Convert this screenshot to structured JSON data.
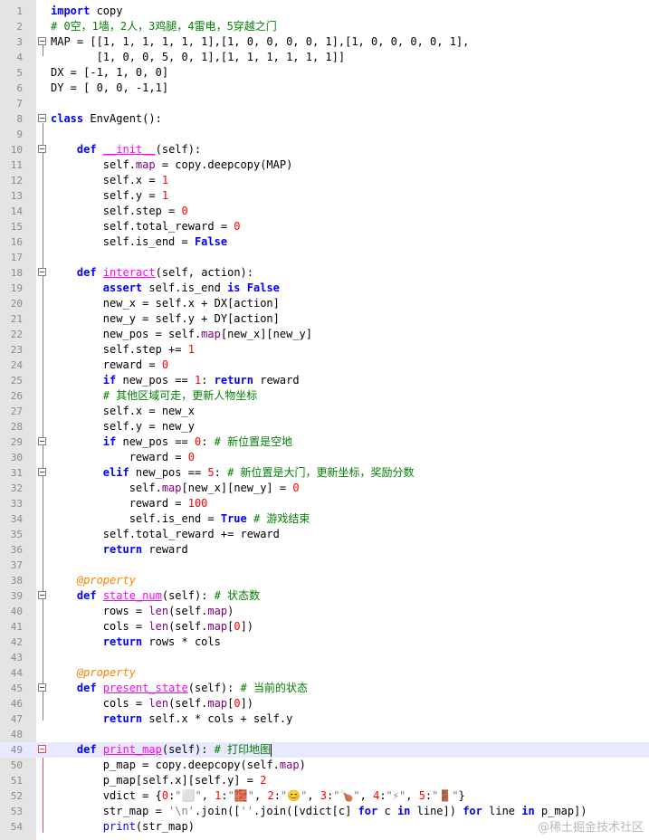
{
  "watermark": "@稀土掘金技术社区",
  "lines": [
    {
      "n": "1",
      "fold": "",
      "current": false,
      "tokens": [
        [
          "kw",
          "import"
        ],
        [
          "t",
          " copy"
        ]
      ]
    },
    {
      "n": "2",
      "fold": "",
      "current": false,
      "tokens": [
        [
          "cm",
          "# 0空，1墙，2人，3鸡腿，4雷电，5穿越之门"
        ]
      ]
    },
    {
      "n": "3",
      "fold": "box",
      "current": false,
      "tokens": [
        [
          "t",
          "MAP = [[1, 1, 1, 1, 1, 1],[1, 0, 0, 0, 0, 1],[1, 0, 0, 0, 0, 1],"
        ]
      ]
    },
    {
      "n": "4",
      "fold": "",
      "current": false,
      "tokens": [
        [
          "t",
          "       [1, 0, 0, 5, 0, 1],[1, 1, 1, 1, 1, 1]]"
        ]
      ]
    },
    {
      "n": "5",
      "fold": "",
      "current": false,
      "tokens": [
        [
          "t",
          "DX = [-1, 1, 0, 0]"
        ]
      ]
    },
    {
      "n": "6",
      "fold": "",
      "current": false,
      "tokens": [
        [
          "t",
          "DY = [ 0, 0, -1,1]"
        ]
      ]
    },
    {
      "n": "7",
      "fold": "",
      "current": false,
      "tokens": []
    },
    {
      "n": "8",
      "fold": "box",
      "current": false,
      "tokens": [
        [
          "kw",
          "class"
        ],
        [
          "t",
          " EnvAgent():"
        ]
      ]
    },
    {
      "n": "9",
      "fold": "",
      "current": false,
      "tokens": []
    },
    {
      "n": "10",
      "fold": "box",
      "current": false,
      "tokens": [
        [
          "t",
          "    "
        ],
        [
          "kw",
          "def"
        ],
        [
          "t",
          " "
        ],
        [
          "fn",
          "__init__"
        ],
        [
          "t",
          "(self):"
        ]
      ]
    },
    {
      "n": "11",
      "fold": "",
      "current": false,
      "tokens": [
        [
          "t",
          "        self."
        ],
        [
          "bi",
          "map"
        ],
        [
          "t",
          " = copy.deepcopy(MAP)"
        ]
      ]
    },
    {
      "n": "12",
      "fold": "",
      "current": false,
      "tokens": [
        [
          "t",
          "        self.x = "
        ],
        [
          "num",
          "1"
        ]
      ]
    },
    {
      "n": "13",
      "fold": "",
      "current": false,
      "tokens": [
        [
          "t",
          "        self.y = "
        ],
        [
          "num",
          "1"
        ]
      ]
    },
    {
      "n": "14",
      "fold": "",
      "current": false,
      "tokens": [
        [
          "t",
          "        self.step = "
        ],
        [
          "num",
          "0"
        ]
      ]
    },
    {
      "n": "15",
      "fold": "",
      "current": false,
      "tokens": [
        [
          "t",
          "        self.total_reward = "
        ],
        [
          "num",
          "0"
        ]
      ]
    },
    {
      "n": "16",
      "fold": "",
      "current": false,
      "tokens": [
        [
          "t",
          "        self.is_end = "
        ],
        [
          "kw",
          "False"
        ]
      ]
    },
    {
      "n": "17",
      "fold": "",
      "current": false,
      "tokens": []
    },
    {
      "n": "18",
      "fold": "box",
      "current": false,
      "tokens": [
        [
          "t",
          "    "
        ],
        [
          "kw",
          "def"
        ],
        [
          "t",
          " "
        ],
        [
          "fn",
          "interact"
        ],
        [
          "t",
          "(self, action):"
        ]
      ]
    },
    {
      "n": "19",
      "fold": "",
      "current": false,
      "tokens": [
        [
          "t",
          "        "
        ],
        [
          "kw",
          "assert"
        ],
        [
          "t",
          " self.is_end "
        ],
        [
          "kw",
          "is"
        ],
        [
          "t",
          " "
        ],
        [
          "kw",
          "False"
        ]
      ]
    },
    {
      "n": "20",
      "fold": "",
      "current": false,
      "tokens": [
        [
          "t",
          "        new_x = self.x + DX[action]"
        ]
      ]
    },
    {
      "n": "21",
      "fold": "",
      "current": false,
      "tokens": [
        [
          "t",
          "        new_y = self.y + DY[action]"
        ]
      ]
    },
    {
      "n": "22",
      "fold": "",
      "current": false,
      "tokens": [
        [
          "t",
          "        new_pos = self."
        ],
        [
          "bi",
          "map"
        ],
        [
          "t",
          "[new_x][new_y]"
        ]
      ]
    },
    {
      "n": "23",
      "fold": "",
      "current": false,
      "tokens": [
        [
          "t",
          "        self.step += "
        ],
        [
          "num",
          "1"
        ]
      ]
    },
    {
      "n": "24",
      "fold": "",
      "current": false,
      "tokens": [
        [
          "t",
          "        reward = "
        ],
        [
          "num",
          "0"
        ]
      ]
    },
    {
      "n": "25",
      "fold": "",
      "current": false,
      "tokens": [
        [
          "t",
          "        "
        ],
        [
          "kw",
          "if"
        ],
        [
          "t",
          " new_pos == "
        ],
        [
          "num",
          "1"
        ],
        [
          "t",
          ": "
        ],
        [
          "kw",
          "return"
        ],
        [
          "t",
          " reward"
        ]
      ]
    },
    {
      "n": "26",
      "fold": "",
      "current": false,
      "tokens": [
        [
          "t",
          "        "
        ],
        [
          "cm",
          "# 其他区域可走，更新人物坐标"
        ]
      ]
    },
    {
      "n": "27",
      "fold": "",
      "current": false,
      "tokens": [
        [
          "t",
          "        self.x = new_x"
        ]
      ]
    },
    {
      "n": "28",
      "fold": "",
      "current": false,
      "tokens": [
        [
          "t",
          "        self.y = new_y"
        ]
      ]
    },
    {
      "n": "29",
      "fold": "box",
      "current": false,
      "tokens": [
        [
          "t",
          "        "
        ],
        [
          "kw",
          "if"
        ],
        [
          "t",
          " new_pos == "
        ],
        [
          "num",
          "0"
        ],
        [
          "t",
          ": "
        ],
        [
          "cm",
          "# 新位置是空地"
        ]
      ]
    },
    {
      "n": "30",
      "fold": "",
      "current": false,
      "tokens": [
        [
          "t",
          "            reward = "
        ],
        [
          "num",
          "0"
        ]
      ]
    },
    {
      "n": "31",
      "fold": "box",
      "current": false,
      "tokens": [
        [
          "t",
          "        "
        ],
        [
          "kw",
          "elif"
        ],
        [
          "t",
          " new_pos == "
        ],
        [
          "num",
          "5"
        ],
        [
          "t",
          ": "
        ],
        [
          "cm",
          "# 新位置是大门，更新坐标，奖励分数"
        ]
      ]
    },
    {
      "n": "32",
      "fold": "",
      "current": false,
      "tokens": [
        [
          "t",
          "            self."
        ],
        [
          "bi",
          "map"
        ],
        [
          "t",
          "[new_x][new_y] = "
        ],
        [
          "num",
          "0"
        ]
      ]
    },
    {
      "n": "33",
      "fold": "",
      "current": false,
      "tokens": [
        [
          "t",
          "            reward = "
        ],
        [
          "num",
          "100"
        ]
      ]
    },
    {
      "n": "34",
      "fold": "",
      "current": false,
      "tokens": [
        [
          "t",
          "            self.is_end = "
        ],
        [
          "kw",
          "True"
        ],
        [
          "t",
          " "
        ],
        [
          "cm",
          "# 游戏结束"
        ]
      ]
    },
    {
      "n": "35",
      "fold": "",
      "current": false,
      "tokens": [
        [
          "t",
          "        self.total_reward += reward"
        ]
      ]
    },
    {
      "n": "36",
      "fold": "",
      "current": false,
      "tokens": [
        [
          "t",
          "        "
        ],
        [
          "kw",
          "return"
        ],
        [
          "t",
          " reward"
        ]
      ]
    },
    {
      "n": "37",
      "fold": "",
      "current": false,
      "tokens": []
    },
    {
      "n": "38",
      "fold": "",
      "current": false,
      "tokens": [
        [
          "t",
          "    "
        ],
        [
          "dec",
          "@property"
        ]
      ]
    },
    {
      "n": "39",
      "fold": "box",
      "current": false,
      "tokens": [
        [
          "t",
          "    "
        ],
        [
          "kw",
          "def"
        ],
        [
          "t",
          " "
        ],
        [
          "fn",
          "state_num"
        ],
        [
          "t",
          "(self): "
        ],
        [
          "cm",
          "# 状态数"
        ]
      ]
    },
    {
      "n": "40",
      "fold": "",
      "current": false,
      "tokens": [
        [
          "t",
          "        rows = "
        ],
        [
          "bi",
          "len"
        ],
        [
          "t",
          "(self."
        ],
        [
          "bi",
          "map"
        ],
        [
          "t",
          ")"
        ]
      ]
    },
    {
      "n": "41",
      "fold": "",
      "current": false,
      "tokens": [
        [
          "t",
          "        cols = "
        ],
        [
          "bi",
          "len"
        ],
        [
          "t",
          "(self."
        ],
        [
          "bi",
          "map"
        ],
        [
          "t",
          "["
        ],
        [
          "num",
          "0"
        ],
        [
          "t",
          "])"
        ]
      ]
    },
    {
      "n": "42",
      "fold": "",
      "current": false,
      "tokens": [
        [
          "t",
          "        "
        ],
        [
          "kw",
          "return"
        ],
        [
          "t",
          " rows * cols"
        ]
      ]
    },
    {
      "n": "43",
      "fold": "",
      "current": false,
      "tokens": []
    },
    {
      "n": "44",
      "fold": "",
      "current": false,
      "tokens": [
        [
          "t",
          "    "
        ],
        [
          "dec",
          "@property"
        ]
      ]
    },
    {
      "n": "45",
      "fold": "box",
      "current": false,
      "tokens": [
        [
          "t",
          "    "
        ],
        [
          "kw",
          "def"
        ],
        [
          "t",
          " "
        ],
        [
          "fn",
          "present_state"
        ],
        [
          "t",
          "(self): "
        ],
        [
          "cm",
          "# 当前的状态"
        ]
      ]
    },
    {
      "n": "46",
      "fold": "",
      "current": false,
      "tokens": [
        [
          "t",
          "        cols = "
        ],
        [
          "bi",
          "len"
        ],
        [
          "t",
          "(self."
        ],
        [
          "bi",
          "map"
        ],
        [
          "t",
          "["
        ],
        [
          "num",
          "0"
        ],
        [
          "t",
          "])"
        ]
      ]
    },
    {
      "n": "47",
      "fold": "",
      "current": false,
      "tokens": [
        [
          "t",
          "        "
        ],
        [
          "kw",
          "return"
        ],
        [
          "t",
          " self.x * cols + self.y"
        ]
      ]
    },
    {
      "n": "48",
      "fold": "",
      "current": false,
      "tokens": []
    },
    {
      "n": "49",
      "fold": "red",
      "current": true,
      "tokens": [
        [
          "t",
          "    "
        ],
        [
          "kw",
          "def"
        ],
        [
          "t",
          " "
        ],
        [
          "fn",
          "print_map"
        ],
        [
          "t",
          "(self): "
        ],
        [
          "cm",
          "# 打印地图"
        ],
        [
          "cursor",
          ""
        ]
      ]
    },
    {
      "n": "50",
      "fold": "",
      "current": false,
      "tokens": [
        [
          "t",
          "        p_map = copy.deepcopy(self."
        ],
        [
          "bi",
          "map"
        ],
        [
          "t",
          ")"
        ]
      ]
    },
    {
      "n": "51",
      "fold": "",
      "current": false,
      "tokens": [
        [
          "t",
          "        p_map[self.x][self.y] = "
        ],
        [
          "num",
          "2"
        ]
      ]
    },
    {
      "n": "52",
      "fold": "",
      "current": false,
      "tokens": [
        [
          "t",
          "        vdict = {"
        ],
        [
          "num",
          "0"
        ],
        [
          "t",
          ":"
        ],
        [
          "str",
          "\"⬜\""
        ],
        [
          "t",
          ", "
        ],
        [
          "num",
          "1"
        ],
        [
          "t",
          ":"
        ],
        [
          "str",
          "\"🧱\""
        ],
        [
          "t",
          ", "
        ],
        [
          "num",
          "2"
        ],
        [
          "t",
          ":"
        ],
        [
          "str",
          "\"😊\""
        ],
        [
          "t",
          ", "
        ],
        [
          "num",
          "3"
        ],
        [
          "t",
          ":"
        ],
        [
          "str",
          "\"🍗\""
        ],
        [
          "t",
          ", "
        ],
        [
          "num",
          "4"
        ],
        [
          "t",
          ":"
        ],
        [
          "str",
          "\"⚡\""
        ],
        [
          "t",
          ", "
        ],
        [
          "num",
          "5"
        ],
        [
          "t",
          ":"
        ],
        [
          "str",
          "\"🚪\""
        ],
        [
          "t",
          "}"
        ]
      ]
    },
    {
      "n": "53",
      "fold": "",
      "current": false,
      "tokens": [
        [
          "t",
          "        str_map = "
        ],
        [
          "str",
          "'\\n'"
        ],
        [
          "t",
          ".join(["
        ],
        [
          "str",
          "''"
        ],
        [
          "t",
          ".join([vdict[c] "
        ],
        [
          "kw",
          "for"
        ],
        [
          "t",
          " c "
        ],
        [
          "kw",
          "in"
        ],
        [
          "t",
          " line]) "
        ],
        [
          "kw",
          "for"
        ],
        [
          "t",
          " line "
        ],
        [
          "kw",
          "in"
        ],
        [
          "t",
          " p_map])"
        ]
      ]
    },
    {
      "n": "54",
      "fold": "",
      "current": false,
      "tokens": [
        [
          "t",
          "        "
        ],
        [
          "kw2",
          "print"
        ],
        [
          "t",
          "(str_map)"
        ]
      ]
    }
  ]
}
